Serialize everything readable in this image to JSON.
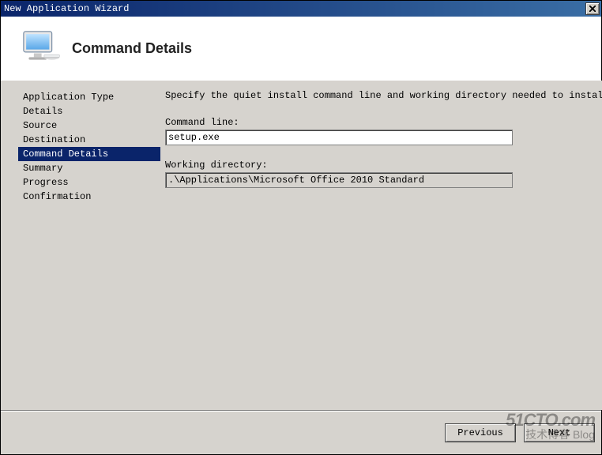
{
  "titlebar": {
    "title": "New Application Wizard",
    "close_label": "✕"
  },
  "header": {
    "heading": "Command Details",
    "icon_name": "computer-monitor-icon"
  },
  "sidebar": {
    "items": [
      {
        "label": "Application Type",
        "selected": false
      },
      {
        "label": "Details",
        "selected": false
      },
      {
        "label": "Source",
        "selected": false
      },
      {
        "label": "Destination",
        "selected": false
      },
      {
        "label": "Command Details",
        "selected": true
      },
      {
        "label": "Summary",
        "selected": false
      },
      {
        "label": "Progress",
        "selected": false
      },
      {
        "label": "Confirmation",
        "selected": false
      }
    ]
  },
  "main": {
    "instruction": "Specify the quiet install command line and working directory needed to install this ap",
    "command_line_label": "Command line:",
    "command_line_value": "setup.exe",
    "working_dir_label": "Working directory:",
    "working_dir_value": ".\\Applications\\Microsoft Office 2010 Standard"
  },
  "footer": {
    "previous_label": "Previous",
    "next_label": "Next"
  },
  "watermark": {
    "line1": "51CTO.com",
    "line2": "技术博客 Blog"
  }
}
